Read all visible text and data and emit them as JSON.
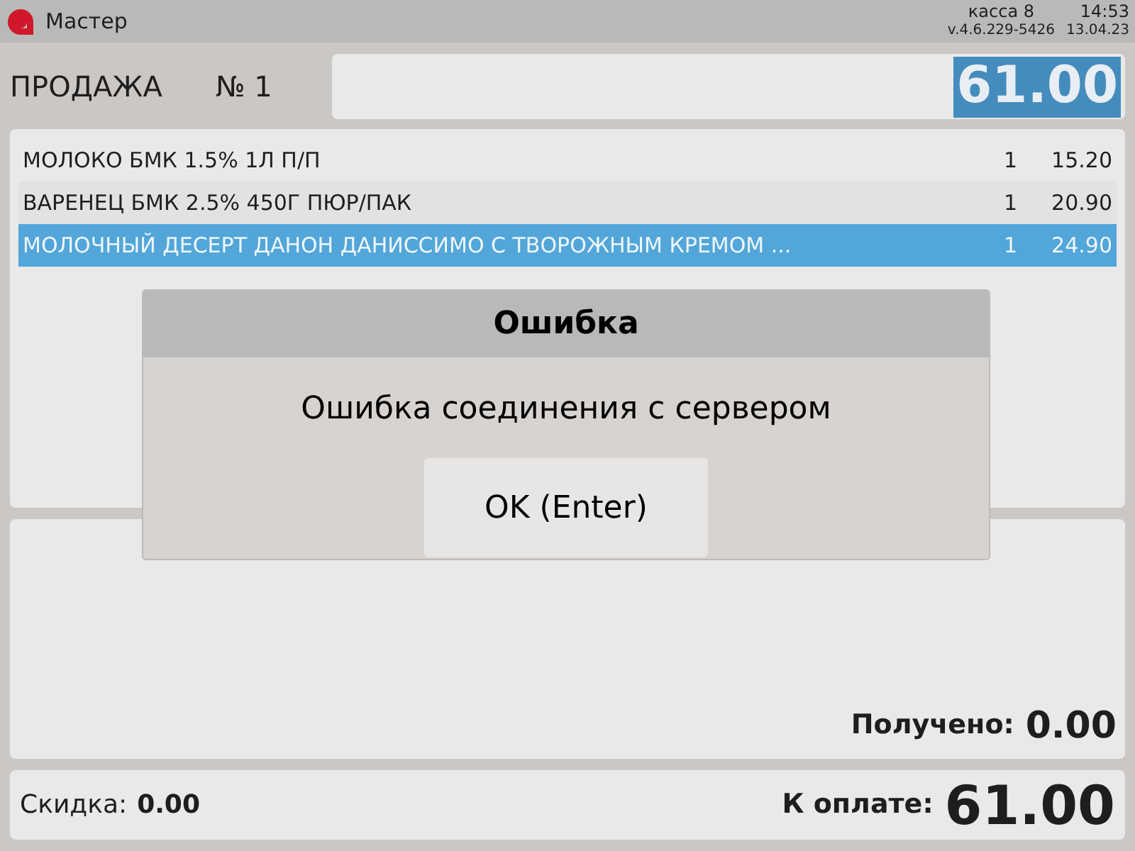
{
  "top_bar": {
    "title": "Мастер",
    "register": "касса 8",
    "time": "14:53",
    "version": "v.4.6.229-5426",
    "date": "13.04.23"
  },
  "sale": {
    "title": "ПРОДАЖА",
    "number": "№ 1",
    "total": "61.00"
  },
  "items": [
    {
      "name": "МОЛОКО БМК 1.5% 1Л П/П",
      "qty": "1",
      "price": "15.20",
      "selected": false
    },
    {
      "name": "ВАРЕНЕЦ БМК 2.5% 450Г ПЮР/ПАК",
      "qty": "1",
      "price": "20.90",
      "selected": false
    },
    {
      "name": "МОЛОЧНЫЙ ДЕСЕРТ ДАНОН ДАНИССИМО С ТВОРОЖНЫМ КРЕМОМ ...",
      "qty": "1",
      "price": "24.90",
      "selected": true
    }
  ],
  "received": {
    "label": "Получено:",
    "value": "0.00"
  },
  "footer": {
    "discount_label": "Скидка:",
    "discount": "0.00",
    "pay_label": "К оплате:",
    "pay": "61.00"
  },
  "dialog": {
    "title": "Ошибка",
    "message": "Ошибка соединения с сервером",
    "button": "OK (Enter)"
  }
}
